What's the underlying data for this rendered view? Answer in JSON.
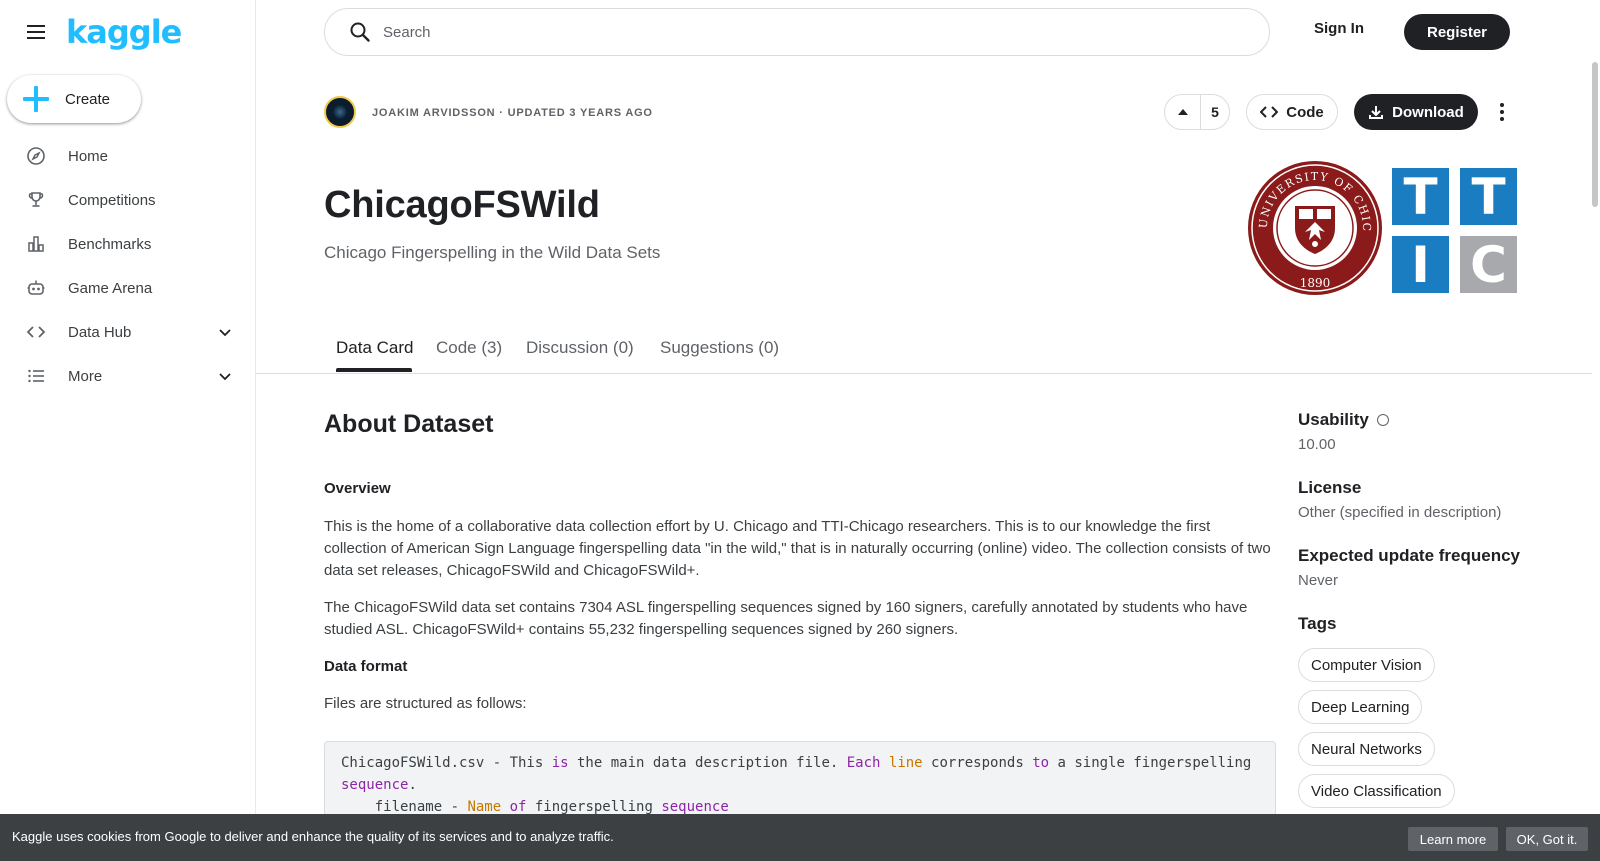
{
  "sidebar": {
    "logo": "kaggle",
    "create_label": "Create",
    "items": [
      {
        "label": "Home",
        "icon": "compass-icon"
      },
      {
        "label": "Competitions",
        "icon": "trophy-icon"
      },
      {
        "label": "Benchmarks",
        "icon": "bar-chart-icon"
      },
      {
        "label": "Game Arena",
        "icon": "robot-icon"
      },
      {
        "label": "Data Hub",
        "icon": "code-icon"
      },
      {
        "label": "More",
        "icon": "list-icon"
      }
    ]
  },
  "header": {
    "search_placeholder": "Search",
    "sign_in": "Sign In",
    "register": "Register"
  },
  "dataset": {
    "meta": "JOAKIM ARVIDSSON · UPDATED 3 YEARS AGO",
    "vote_count": "5",
    "code_label": "Code",
    "download_label": "Download",
    "title": "ChicagoFSWild",
    "subtitle": "Chicago Fingerspelling in the Wild Data Sets",
    "tabs": [
      "Data Card",
      "Code (3)",
      "Discussion (0)",
      "Suggestions (0)"
    ],
    "active_tab": 0
  },
  "about": {
    "heading": "About Dataset",
    "overview_heading": "Overview",
    "para1": "This is the home of a collaborative data collection effort by U. Chicago and TTI-Chicago researchers. This is to our knowledge the first collection of American Sign Language fingerspelling data \"in the wild,\" that is in naturally occurring (online) video. The collection consists of two data set releases, ChicagoFSWild and ChicagoFSWild+.",
    "para2": "The ChicagoFSWild data set contains 7304 ASL fingerspelling sequences signed by 160 signers, carefully annotated by students who have studied ASL. ChicagoFSWild+ contains 55,232 fingerspelling sequences signed by 260 signers.",
    "format_heading": "Data format",
    "para3": "Files are structured as follows:"
  },
  "sidepanel": {
    "usability_label": "Usability",
    "usability_value": "10.00",
    "license_label": "License",
    "license_value": "Other (specified in description)",
    "frequency_label": "Expected update frequency",
    "frequency_value": "Never",
    "tags_label": "Tags",
    "tags": [
      "Computer Vision",
      "Deep Learning",
      "Neural Networks",
      "Video Classification"
    ]
  },
  "logos": {
    "seal_top": "THE UNIVERSITY OF CHICAGO",
    "seal_year": "1890",
    "ttic_letters": [
      "T",
      "T",
      "I",
      "C"
    ]
  },
  "cookie": {
    "message": "Kaggle uses cookies from Google to deliver and enhance the quality of its services and to analyze traffic.",
    "learn_more": "Learn more",
    "ok": "OK, Got it."
  },
  "colors": {
    "kaggle_blue": "#20beff",
    "dark": "#202124",
    "uc_maroon": "#8b1a1a",
    "ttic_blue": "#1a7dc1",
    "ttic_gray": "#a8a9ad"
  }
}
